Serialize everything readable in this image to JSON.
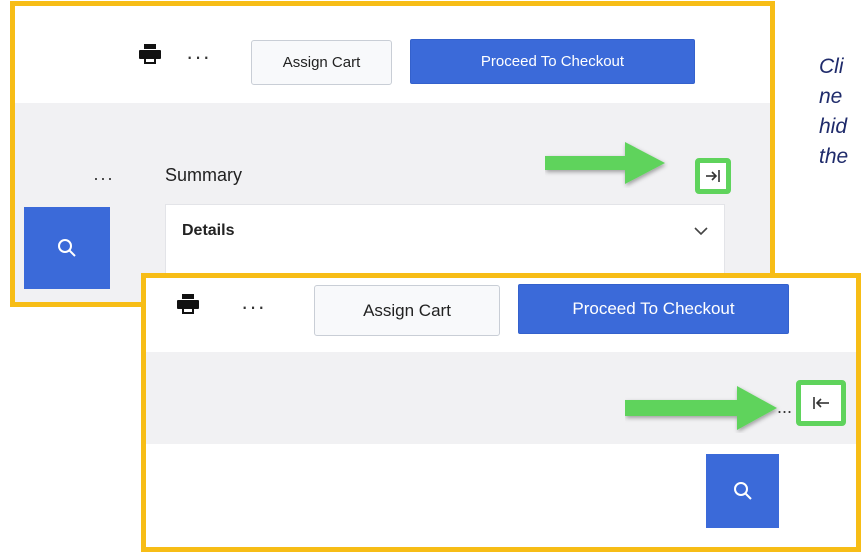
{
  "top_panel": {
    "toolbar": {
      "more_label": "···",
      "assign_cart_label": "Assign Cart",
      "proceed_label": "Proceed To Checkout"
    },
    "side_more_label": "···",
    "summary_title": "Summary",
    "details_label": "Details"
  },
  "bottom_panel": {
    "toolbar": {
      "more_label": "···",
      "assign_cart_label": "Assign Cart",
      "proceed_label": "Proceed To Checkout"
    },
    "more_label": "..."
  },
  "caption_lines": [
    "Cli",
    "ne",
    "hid",
    "the"
  ],
  "colors": {
    "frame": "#f7bd16",
    "highlight": "#5fd35c",
    "primary_button": "#3b6ad9",
    "caption": "#1f2b6b"
  },
  "icons": {
    "print": "printer-icon",
    "search": "search-icon",
    "collapse": "collapse-right-icon",
    "expand": "expand-left-icon",
    "chevron": "chevron-down-icon",
    "arrow": "arrow-right-icon"
  }
}
